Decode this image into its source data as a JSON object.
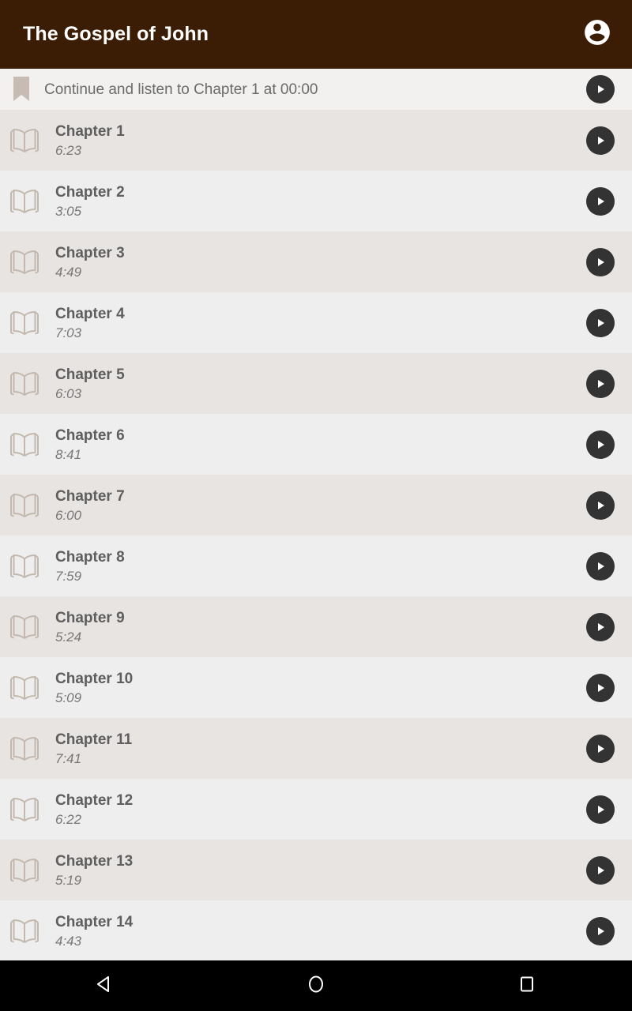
{
  "app_bar": {
    "title": "The Gospel of John",
    "account_icon": "account-circle-icon",
    "background_color": "#3b1c04",
    "title_color": "#ffffff"
  },
  "continue_bar": {
    "bookmark_icon": "bookmark-icon",
    "text": "Continue and listen to Chapter 1 at 00:00",
    "play_icon": "play-icon",
    "background_color": "#f2f1f0",
    "text_color": "#6b6b6b"
  },
  "chapter_list": {
    "book_icon": "open-book-icon",
    "play_icon": "play-icon",
    "row_colors": [
      "#e8e4e2",
      "#eeeeee"
    ],
    "items": [
      {
        "title": "Chapter 1",
        "duration": "6:23"
      },
      {
        "title": "Chapter 2",
        "duration": "3:05"
      },
      {
        "title": "Chapter 3",
        "duration": "4:49"
      },
      {
        "title": "Chapter 4",
        "duration": "7:03"
      },
      {
        "title": "Chapter 5",
        "duration": "6:03"
      },
      {
        "title": "Chapter 6",
        "duration": "8:41"
      },
      {
        "title": "Chapter 7",
        "duration": "6:00"
      },
      {
        "title": "Chapter 8",
        "duration": "7:59"
      },
      {
        "title": "Chapter 9",
        "duration": "5:24"
      },
      {
        "title": "Chapter 10",
        "duration": "5:09"
      },
      {
        "title": "Chapter 11",
        "duration": "7:41"
      },
      {
        "title": "Chapter 12",
        "duration": "6:22"
      },
      {
        "title": "Chapter 13",
        "duration": "5:19"
      },
      {
        "title": "Chapter 14",
        "duration": "4:43"
      }
    ]
  },
  "nav_bar": {
    "background_color": "#000000",
    "buttons": [
      {
        "name": "back",
        "icon": "triangle-left-icon"
      },
      {
        "name": "home",
        "icon": "circle-icon"
      },
      {
        "name": "recents",
        "icon": "square-icon"
      }
    ]
  }
}
